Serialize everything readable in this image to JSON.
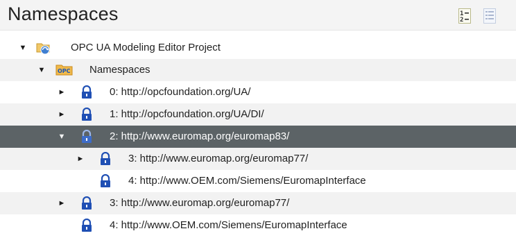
{
  "panel": {
    "title": "Namespaces",
    "sort_icon": "numeric-sort-icon",
    "list_icon": "list-view-icon"
  },
  "tree": [
    {
      "label": "OPC UA Modeling Editor Project",
      "expanded": true,
      "icon": "project-folder-icon"
    },
    {
      "label": "Namespaces",
      "expanded": true,
      "icon": "opc-folder-icon"
    },
    {
      "label": "0: http://opcfoundation.org/UA/",
      "expanded": false,
      "icon": "lock-icon"
    },
    {
      "label": "1: http://opcfoundation.org/UA/DI/",
      "expanded": false,
      "icon": "lock-icon"
    },
    {
      "label": "2: http://www.euromap.org/euromap83/",
      "expanded": true,
      "selected": true,
      "icon": "lock-icon"
    },
    {
      "label": "3: http://www.euromap.org/euromap77/",
      "expanded": false,
      "icon": "lock-icon"
    },
    {
      "label": "4: http://www.OEM.com/Siemens/EuromapInterface",
      "icon": "lock-icon"
    },
    {
      "label": "3: http://www.euromap.org/euromap77/",
      "expanded": false,
      "icon": "lock-icon"
    },
    {
      "label": "4: http://www.OEM.com/Siemens/EuromapInterface",
      "icon": "lock-icon"
    }
  ],
  "colors": {
    "header_bg": "#f4f4f4",
    "alt_row_bg": "#f2f2f2",
    "selected_row_bg": "#5c6366",
    "lock_blue": "#1f4fb4",
    "opc_orange": "#e8a23a"
  },
  "glyphs": {
    "expanded": "▼",
    "collapsed": "►"
  }
}
